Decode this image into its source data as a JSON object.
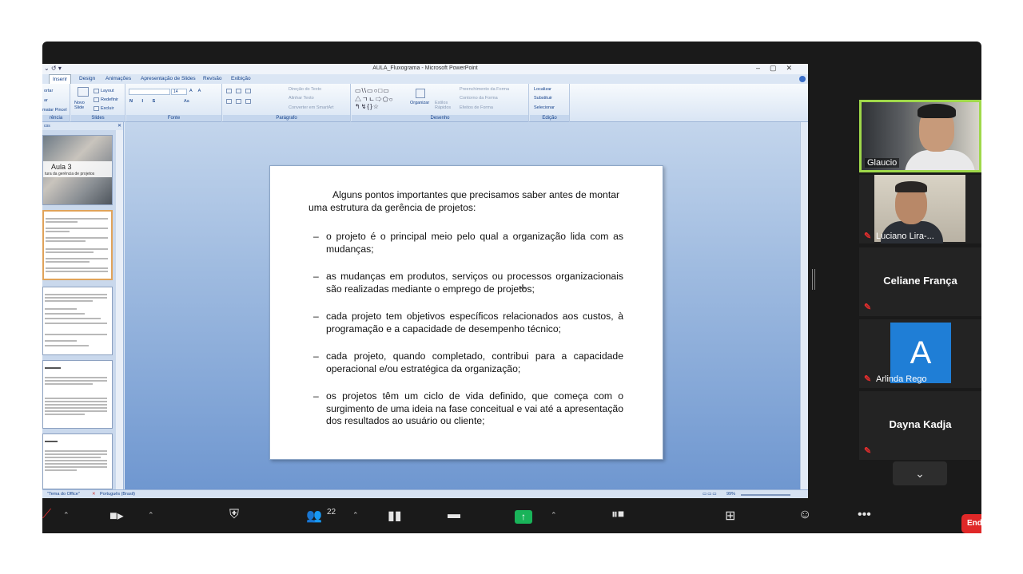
{
  "ppt": {
    "title": "AULA_Fluxograma - Microsoft PowerPoint",
    "tabs": [
      "Inserir",
      "Design",
      "Animações",
      "Apresentação de Slides",
      "Revisão",
      "Exibição"
    ],
    "ribbon": {
      "clipboard": {
        "items": [
          "ortar",
          "ar",
          "matar Pincel"
        ],
        "group": "rência"
      },
      "slides": {
        "new_slide": "Novo Slide",
        "layout": "Layout",
        "reset": "Redefinir",
        "delete": "Excluir",
        "group": "Slides"
      },
      "font": {
        "size": "14",
        "group": "Fonte"
      },
      "paragraph": {
        "direction": "Direção do Texto",
        "align": "Alinhar Texto",
        "smartart": "Converter em SmartArt",
        "group": "Parágrafo"
      },
      "drawing": {
        "arrange": "Organizar",
        "styles": "Estilos Rápidos",
        "fill": "Preenchimento da Forma",
        "outline": "Contorno da Forma",
        "effects": "Efeitos de Forma",
        "group": "Desenho"
      },
      "editing": {
        "find": "Localizar",
        "replace": "Substituir",
        "select": "Selecionar",
        "group": "Edição"
      }
    },
    "pane_tab": "cos",
    "thumb1": {
      "title": "Aula 3",
      "subtitle": "tura da gerência de projetos"
    },
    "slide": {
      "intro": "Alguns pontos importantes que precisamos saber antes de montar uma estrutura da gerência de projetos:",
      "bullets": [
        "o projeto é o principal meio pelo qual a organização lida com as mudanças;",
        "as mudanças em produtos, serviços ou processos organizacionais são realizadas mediante o emprego de projetos;",
        "cada projeto tem objetivos específicos relacionados aos custos, à programação e a capacidade de desempenho técnico;",
        "cada projeto, quando completado, contribui para a capacidade operacional e/ou estratégica da organização;",
        "os projetos têm um ciclo de vida definido, que começa com o surgimento de uma ideia na fase conceitual e vai até a apresentação dos resultados ao usuário ou cliente;"
      ],
      "dash": "–"
    },
    "status": {
      "theme": "\"Tema do Office\"",
      "language": "Português (Brasil)",
      "zoom": "99%"
    }
  },
  "participants": [
    {
      "name": "Glaucio"
    },
    {
      "name": "Luciano Lira-..."
    },
    {
      "name": "Celiane França"
    },
    {
      "name": "Arlinda Rego",
      "initial": "A"
    },
    {
      "name": "Dayna Kadja"
    }
  ],
  "toolbar": {
    "participants_count": "22",
    "end_label": "End"
  },
  "colors": {
    "speaker_border": "#9fd84a",
    "share": "#19b359",
    "end": "#e02828",
    "avatar": "#1f7ed6"
  }
}
